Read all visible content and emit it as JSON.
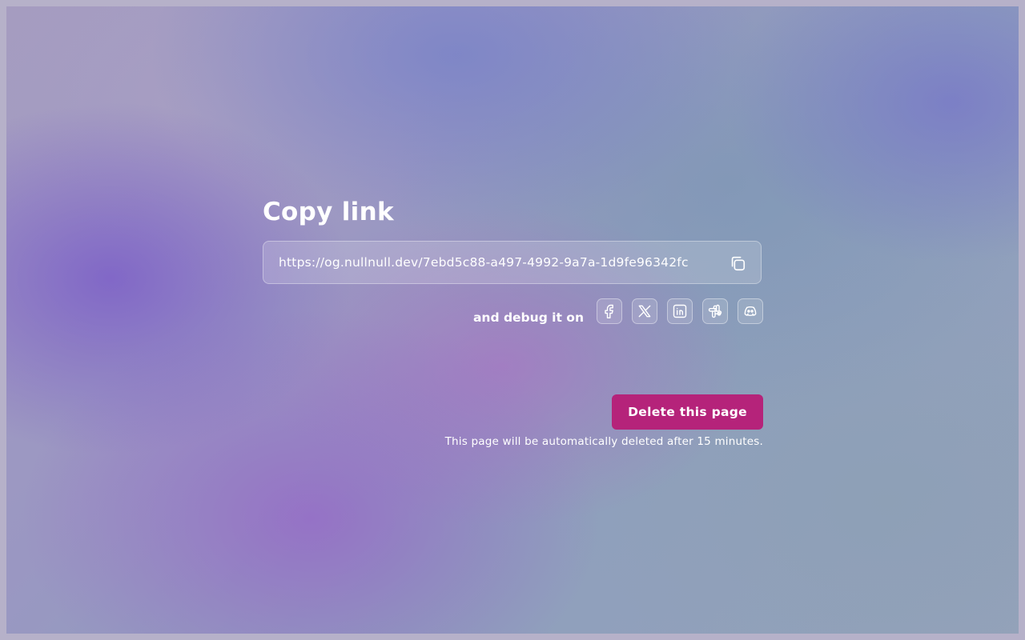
{
  "page": {
    "title": "Copy link",
    "share_url": "https://og.nullnull.dev/7ebd5c88-a497-4992-9a7a-1d9fe96342fc",
    "debug_label": "and debug it on",
    "platforms": [
      {
        "name": "facebook",
        "icon": "facebook-icon"
      },
      {
        "name": "x",
        "icon": "x-icon"
      },
      {
        "name": "linkedin",
        "icon": "linkedin-icon"
      },
      {
        "name": "slack",
        "icon": "slack-icon"
      },
      {
        "name": "discord",
        "icon": "discord-icon"
      }
    ],
    "delete_button": "Delete this page",
    "delete_note": "This page will be automatically deleted after 15 minutes."
  },
  "colors": {
    "accent": "#b5237a",
    "text": "#ffffff"
  }
}
